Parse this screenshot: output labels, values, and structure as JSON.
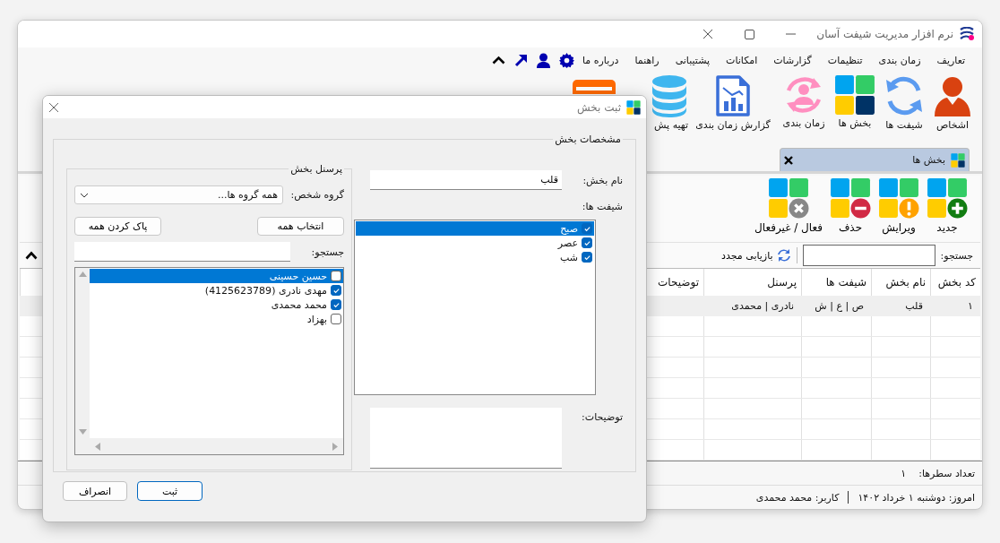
{
  "window": {
    "title": "نرم افزار مدیریت شیفت آسان"
  },
  "menu": [
    "تعاریف",
    "زمان بندی",
    "تنظیمات",
    "گزارشات",
    "امکانات",
    "پشتیبانی",
    "راهنما",
    "درباره ما"
  ],
  "ribbon": [
    {
      "label": "اشخاص",
      "kind": "person"
    },
    {
      "label": "شیفت ها",
      "kind": "cycle"
    },
    {
      "label": "بخش ها",
      "kind": "grid"
    },
    {
      "label": "زمان بندی",
      "kind": "schedule"
    },
    {
      "label": "گزارش زمان بندی",
      "kind": "report"
    },
    {
      "label": "تهیه پش",
      "kind": "database"
    },
    {
      "kind": "orange"
    }
  ],
  "tabs": [
    {
      "label": "بخش ها",
      "selected": true
    }
  ],
  "toolbar": [
    {
      "label": "جدید",
      "kind": "add"
    },
    {
      "label": "ویرایش",
      "kind": "edit"
    },
    {
      "label": "حذف",
      "kind": "delete"
    },
    {
      "label": "فعال / غیرفعال",
      "kind": "toggle"
    }
  ],
  "search": {
    "label": "جستجو:"
  },
  "refresh": {
    "label": "بازیابی مجدد"
  },
  "table": {
    "columns": [
      "کد بخش",
      "نام بخش",
      "شیفت ها",
      "پرسنل",
      "توضیحات"
    ],
    "rows": [
      {
        "cells": [
          "۱",
          "قلب",
          "ص | ع | ش",
          "نادری | محمدی"
        ],
        "selected": true
      }
    ]
  },
  "row_count": {
    "label": "تعداد سطرها:",
    "value": "۱"
  },
  "status_bar": {
    "date": "امروز: دوشنبه ۱ خرداد ۱۴۰۲",
    "user": "کاربر: محمد محمدی"
  },
  "dialog": {
    "title": "ثبت بخش",
    "details_group": "مشخصات بخش",
    "name_label": "نام بخش:",
    "name_value": "قلب",
    "shifts_label": "شیفت ها:",
    "shifts": [
      {
        "label": "صبح",
        "checked": true,
        "selected": true
      },
      {
        "label": "عصر",
        "checked": true,
        "selected": false
      },
      {
        "label": "شب",
        "checked": true,
        "selected": false
      }
    ],
    "notes_label": "توضیحات:",
    "personnel_group": "پرسنل بخش",
    "group_label": "گروه شخص:",
    "group_value": "همه گروه ها...",
    "select_all": "انتخاب همه",
    "clear_all": "پاک کردن همه",
    "search_label": "جستجو:",
    "personnel": [
      {
        "label": "حسین حسینی",
        "checked": false,
        "selected": true
      },
      {
        "label": "مهدی نادری (4125623789)",
        "checked": true,
        "selected": false
      },
      {
        "label": "محمد محمدی",
        "checked": true,
        "selected": false
      },
      {
        "label": "بهزاد",
        "checked": false,
        "selected": false
      }
    ],
    "buttons": [
      {
        "label": "ثبت",
        "default": true
      },
      {
        "label": "انصراف",
        "default": false
      }
    ]
  }
}
